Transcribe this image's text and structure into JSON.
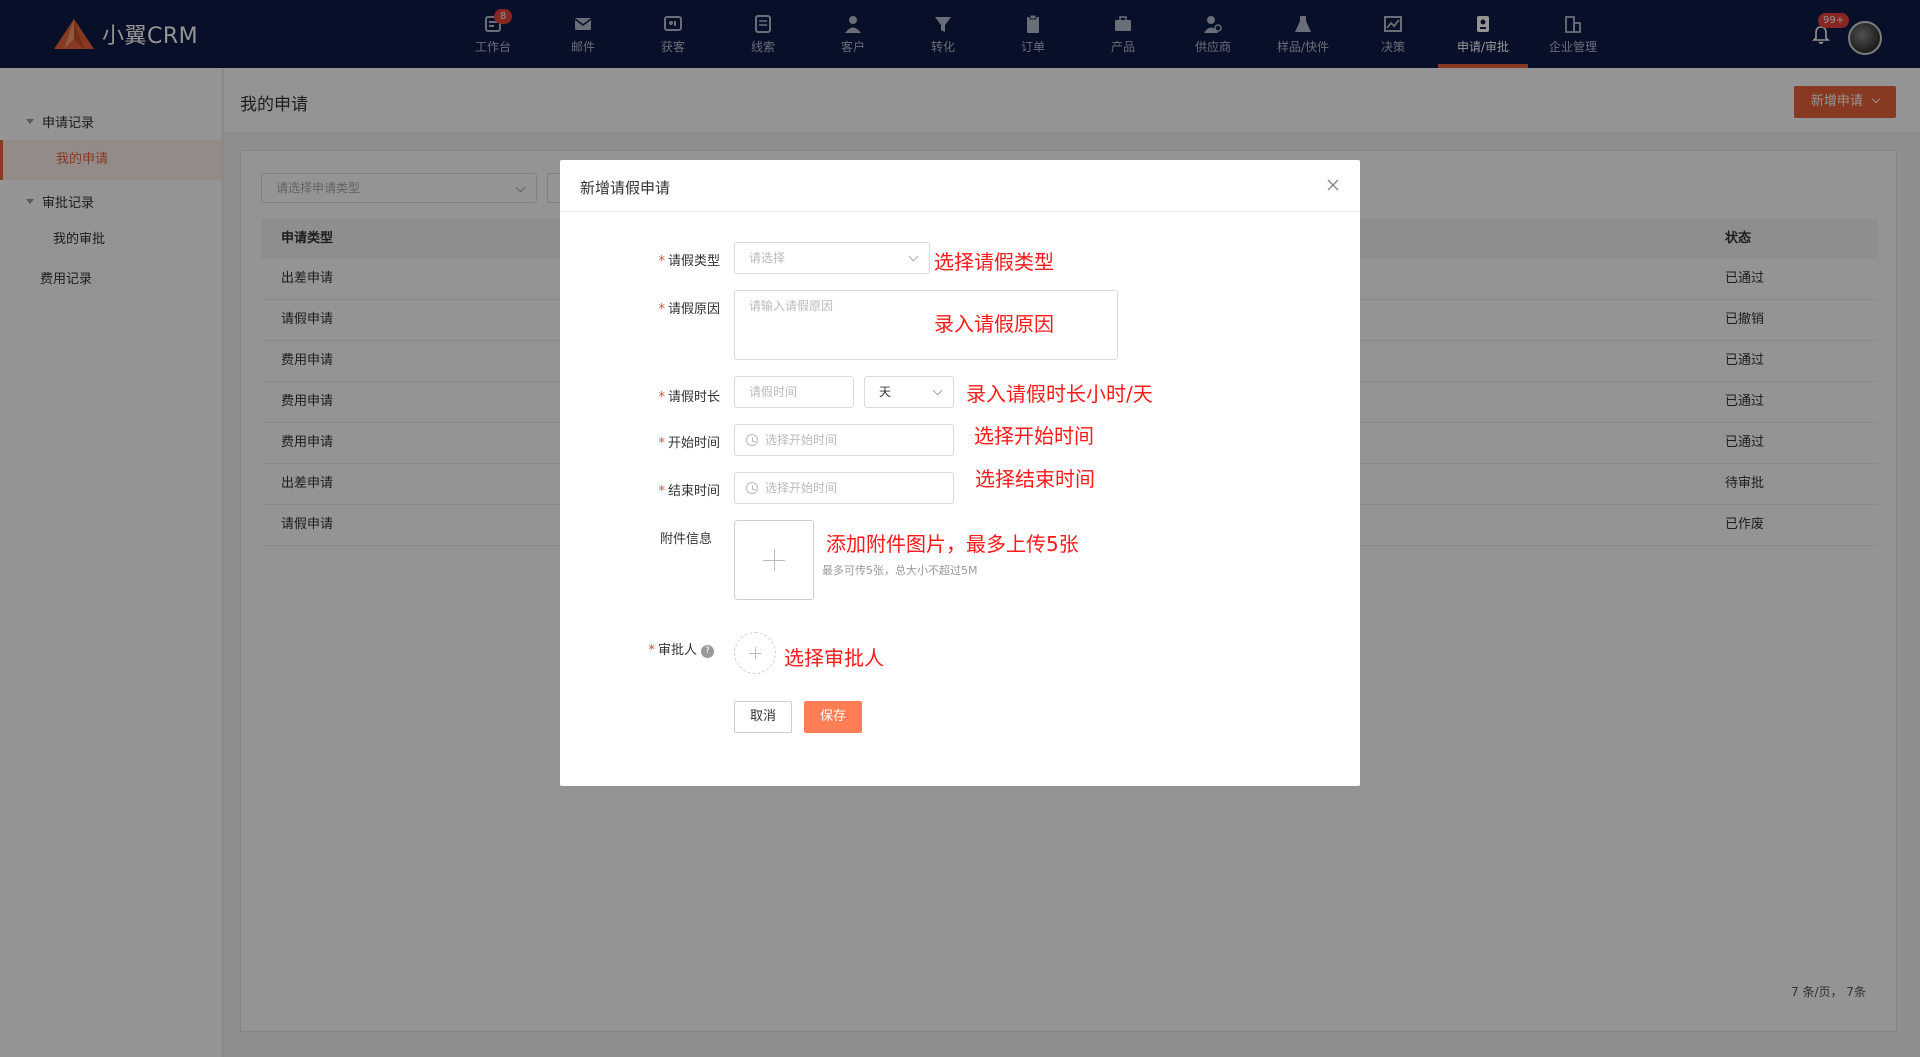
{
  "app": {
    "logo_text": "小翼CRM"
  },
  "nav": {
    "items": [
      {
        "label": "工作台",
        "icon": "dashboard-icon",
        "badge": "8"
      },
      {
        "label": "邮件",
        "icon": "mail-icon"
      },
      {
        "label": "获客",
        "icon": "acquire-icon"
      },
      {
        "label": "线索",
        "icon": "lead-icon"
      },
      {
        "label": "客户",
        "icon": "user-icon"
      },
      {
        "label": "转化",
        "icon": "funnel-icon"
      },
      {
        "label": "订单",
        "icon": "clipboard-icon"
      },
      {
        "label": "产品",
        "icon": "briefcase-icon"
      },
      {
        "label": "供应商",
        "icon": "supplier-icon"
      },
      {
        "label": "样品/快件",
        "icon": "flask-icon"
      },
      {
        "label": "决策",
        "icon": "chart-icon"
      },
      {
        "label": "申请/审批",
        "icon": "approval-icon",
        "active": true
      },
      {
        "label": "企业管理",
        "icon": "building-icon"
      }
    ],
    "notification_badge": "99+",
    "accent_color": "#e8653a"
  },
  "sidebar": {
    "groups": [
      {
        "label": "申请记录",
        "items": [
          "我的申请"
        ]
      },
      {
        "label": "审批记录",
        "items": [
          "我的审批"
        ]
      }
    ],
    "standalone": "费用记录",
    "active_item": "我的申请"
  },
  "main": {
    "page_title": "我的申请",
    "new_button": "新增申请",
    "filter_placeholder": "请选择申请类型",
    "columns": [
      "申请类型",
      "状态"
    ],
    "rows": [
      {
        "type": "出差申请",
        "status": "已通过"
      },
      {
        "type": "请假申请",
        "status": "已撤销"
      },
      {
        "type": "费用申请",
        "status": "已通过"
      },
      {
        "type": "费用申请",
        "status": "已通过"
      },
      {
        "type": "费用申请",
        "status": "已通过"
      },
      {
        "type": "出差申请",
        "status": "待审批"
      },
      {
        "type": "请假申请",
        "status": "已作废"
      }
    ],
    "pager_text": "7 条/页，  7条"
  },
  "modal": {
    "title": "新增请假申请",
    "fields": {
      "leave_type": {
        "label": "请假类型",
        "placeholder": "请选择",
        "annotation": "选择请假类型"
      },
      "reason": {
        "label": "请假原因",
        "placeholder": "请输入请假原因",
        "annotation": "录入请假原因"
      },
      "duration": {
        "label": "请假时长",
        "placeholder": "请假时间",
        "unit": "天",
        "annotation": "录入请假时长小时/天"
      },
      "start": {
        "label": "开始时间",
        "placeholder": "选择开始时间",
        "annotation": "选择开始时间"
      },
      "end": {
        "label": "结束时间",
        "placeholder": "选择开始时间",
        "annotation": "选择结束时间"
      },
      "attachment": {
        "label": "附件信息",
        "hint": "最多可传5张，总大小不超过5M",
        "annotation": "添加附件图片，最多上传5张"
      },
      "approver": {
        "label": "审批人",
        "help": "?",
        "annotation": "选择审批人"
      }
    },
    "required_mark": "*",
    "cancel": "取消",
    "save": "保存"
  }
}
